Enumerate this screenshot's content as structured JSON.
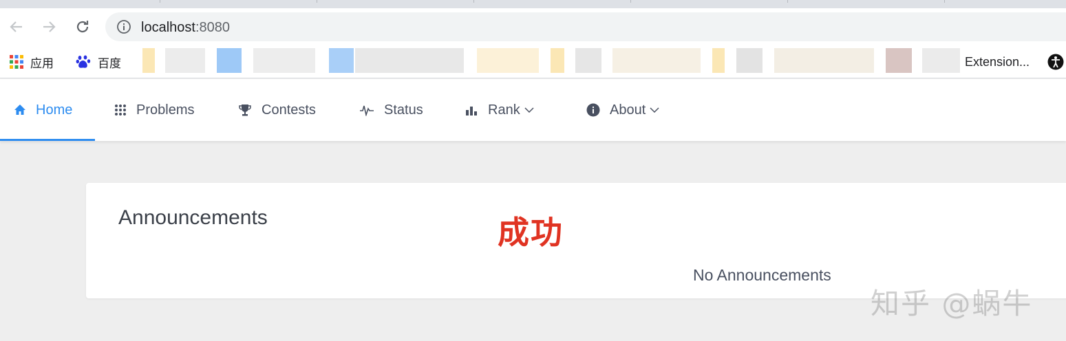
{
  "browser": {
    "url_host": "localhost",
    "url_port": ":8080",
    "bookmarks": {
      "apps_label": "应用",
      "baidu_label": "百度",
      "extensions_label": "Extension..."
    }
  },
  "nav": {
    "items": [
      {
        "label": "Home",
        "icon": "home-icon",
        "active": true
      },
      {
        "label": "Problems",
        "icon": "grid-icon"
      },
      {
        "label": "Contests",
        "icon": "trophy-icon"
      },
      {
        "label": "Status",
        "icon": "pulse-icon"
      },
      {
        "label": "Rank",
        "icon": "bar-chart-icon",
        "dropdown": true
      },
      {
        "label": "About",
        "icon": "info-icon",
        "dropdown": true
      }
    ],
    "accent_color": "#2d8cf0"
  },
  "announcements": {
    "title": "Announcements",
    "annotation": "成功",
    "empty_text": "No Announcements"
  },
  "watermark": "知乎 @蜗牛"
}
